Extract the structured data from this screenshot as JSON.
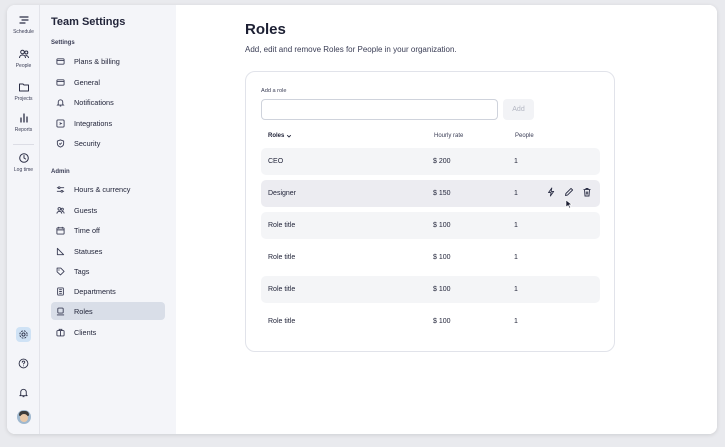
{
  "rail": {
    "items": [
      {
        "label": "Schedule",
        "icon": "schedule-icon"
      },
      {
        "label": "People",
        "icon": "people-icon"
      },
      {
        "label": "Projects",
        "icon": "folder-icon"
      },
      {
        "label": "Reports",
        "icon": "bar-chart-icon"
      },
      {
        "label": "Log time",
        "icon": "clock-icon"
      }
    ],
    "bottom_icons": [
      "gear-icon",
      "help-icon",
      "bell-icon",
      "avatar"
    ]
  },
  "sidebar": {
    "title": "Team Settings",
    "settings_section": "Settings",
    "settings_items": [
      {
        "label": "Plans & billing",
        "icon": "credit-card-icon"
      },
      {
        "label": "General",
        "icon": "window-icon"
      },
      {
        "label": "Notifications",
        "icon": "bell-icon"
      },
      {
        "label": "Integrations",
        "icon": "integrations-icon"
      },
      {
        "label": "Security",
        "icon": "shield-icon"
      }
    ],
    "admin_section": "Admin",
    "admin_items": [
      {
        "label": "Hours & currency",
        "icon": "sliders-icon"
      },
      {
        "label": "Guests",
        "icon": "guests-icon"
      },
      {
        "label": "Time off",
        "icon": "calendar-icon"
      },
      {
        "label": "Statuses",
        "icon": "status-icon"
      },
      {
        "label": "Tags",
        "icon": "tag-icon"
      },
      {
        "label": "Departments",
        "icon": "building-icon"
      },
      {
        "label": "Roles",
        "icon": "roles-icon",
        "active": true
      },
      {
        "label": "Clients",
        "icon": "briefcase-icon"
      }
    ]
  },
  "main": {
    "title": "Roles",
    "subtitle": "Add, edit and remove Roles for People in your organization.",
    "add_role": {
      "label": "Add a role",
      "value": "",
      "placeholder": "",
      "button": "Add"
    },
    "table": {
      "columns": [
        "Roles",
        "Hourly rate",
        "People"
      ],
      "rows": [
        {
          "name": "CEO",
          "rate": "$ 200",
          "people": "1"
        },
        {
          "name": "Designer",
          "rate": "$ 150",
          "people": "1"
        },
        {
          "name": "Role title",
          "rate": "$ 100",
          "people": "1"
        },
        {
          "name": "Role title",
          "rate": "$ 100",
          "people": "1"
        },
        {
          "name": "Role title",
          "rate": "$ 100",
          "people": "1"
        },
        {
          "name": "Role title",
          "rate": "$ 100",
          "people": "1"
        }
      ]
    }
  },
  "colors": {
    "accent": "#cfe2f5",
    "active_nav": "#d9dee8",
    "row_shade": "#f4f5f7",
    "row_hover": "#ececf1"
  }
}
